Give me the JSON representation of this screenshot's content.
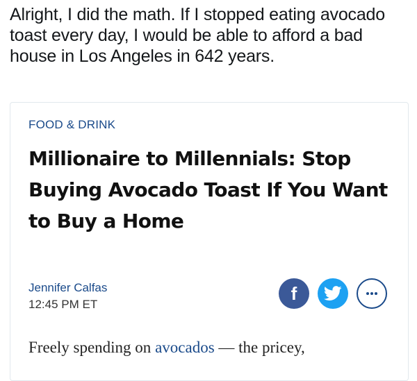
{
  "tweet": {
    "text": "Alright, I did the math. If I stopped eating avocado toast every day, I would be able to afford a bad house in Los Angeles in 642 years."
  },
  "card": {
    "section": "FOOD & DRINK",
    "headline": "Millionaire to Millennials: Stop Buying Avocado Toast If You Want to Buy a Home",
    "author": "Jennifer Calfas",
    "time": "12:45 PM ET",
    "share": {
      "facebook_label": "f",
      "more_label": "..."
    },
    "body": {
      "before": "Freely spending on ",
      "link": "avocados",
      "after": " — the pricey,"
    }
  },
  "colors": {
    "link": "#1a4a8a",
    "facebook": "#3b5998",
    "twitter": "#1da1f2"
  }
}
